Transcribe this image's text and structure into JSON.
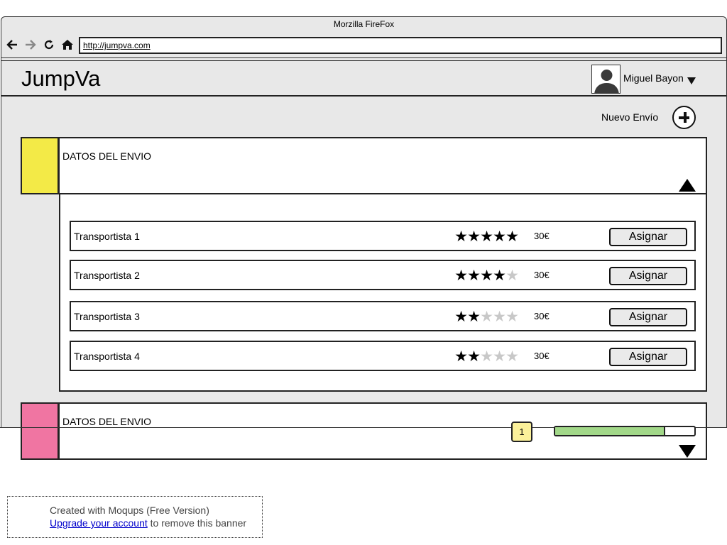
{
  "browser": {
    "title": "Morzilla FireFox",
    "url": "http://jumpva.com",
    "icons": [
      "back-arrow-icon",
      "forward-arrow-icon",
      "reload-icon",
      "home-icon"
    ]
  },
  "app": {
    "brand": "JumpVa",
    "user": {
      "name": "Miguel Bayon"
    },
    "new_shipment_label": "Nuevo Envío"
  },
  "panels": [
    {
      "title": "DATOS DEL ENVIO",
      "color": "#f3ea47",
      "expanded": true
    },
    {
      "title": "DATOS DEL ENVIO",
      "color": "#f075a2",
      "expanded": false,
      "badge": "1",
      "progress_fraction": 0.79,
      "progress_color": "#a2d889"
    }
  ],
  "carriers": [
    {
      "name": "Transportista 1",
      "rating": 5,
      "max_rating": 5,
      "price": "30€",
      "button": "Asignar"
    },
    {
      "name": "Transportista 2",
      "rating": 4,
      "max_rating": 5,
      "price": "30€",
      "button": "Asignar"
    },
    {
      "name": "Transportista 3",
      "rating": 2,
      "max_rating": 5,
      "price": "30€",
      "button": "Asignar"
    },
    {
      "name": "Transportista 4",
      "rating": 2,
      "max_rating": 5,
      "price": "30€",
      "button": "Asignar"
    }
  ],
  "banner": {
    "line1": "Created with Moqups (Free Version)",
    "link": "Upgrade your account",
    "suffix": " to remove this banner"
  }
}
